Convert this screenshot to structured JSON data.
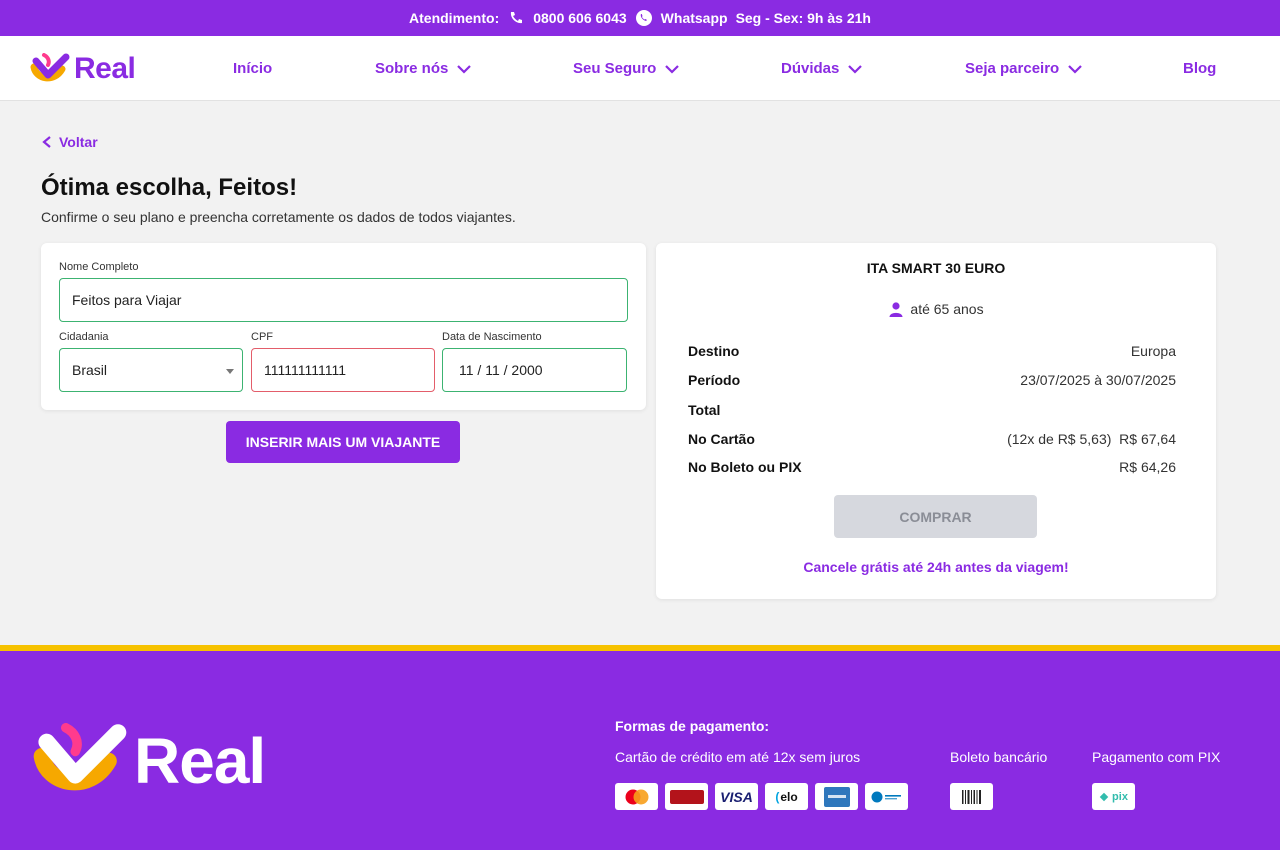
{
  "topbar": {
    "label": "Atendimento:",
    "phone": "0800 606 6043",
    "whatsapp": "Whatsapp",
    "hours": "Seg - Sex: 9h às 21h"
  },
  "nav": {
    "logo": "Real",
    "items": [
      {
        "label": "Início"
      },
      {
        "label": "Sobre nós"
      },
      {
        "label": "Seu Seguro"
      },
      {
        "label": "Dúvidas"
      },
      {
        "label": "Seja parceiro"
      },
      {
        "label": "Blog"
      }
    ]
  },
  "page": {
    "back": "Voltar",
    "title": "Ótima escolha, Feitos!",
    "subtitle": "Confirme o seu plano e preencha corretamente os dados de todos viajantes."
  },
  "form": {
    "name_label": "Nome Completo",
    "name_value": "Feitos para Viajar",
    "citizenship_label": "Cidadania",
    "citizenship_value": "Brasil",
    "cpf_label": "CPF",
    "cpf_value": "111111111111",
    "birth_label": "Data de Nascimento",
    "birth_value": "11 / 11 / 2000",
    "add_button": "INSERIR MAIS UM VIAJANTE"
  },
  "summary": {
    "plan": "ITA SMART 30 EURO",
    "age": "até 65 anos",
    "rows": [
      {
        "k": "Destino",
        "v": "Europa"
      },
      {
        "k": "Período",
        "v": "23/07/2025 à 30/07/2025"
      },
      {
        "k": "Total",
        "v": ""
      },
      {
        "k": "No Cartão",
        "v": "(12x de R$ 5,63)  R$ 67,64"
      },
      {
        "k": "No Boleto ou PIX",
        "v": "R$ 64,26"
      }
    ],
    "buy": "COMPRAR",
    "cancel": "Cancele grátis até 24h antes da viagem!"
  },
  "footer": {
    "logo": "Real",
    "pay_title": "Formas de pagamento:",
    "card_label": "Cartão de crédito em até 12x sem juros",
    "boleto_label": "Boleto bancário",
    "pix_label": "Pagamento com PIX",
    "cards": [
      "mastercard-icon",
      "hipercard-icon",
      "visa-icon",
      "elo-icon",
      "amex-icon",
      "diners-icon"
    ],
    "visa_text": "VISA",
    "elo_text": "elo",
    "pix_text": "pix"
  },
  "colors": {
    "brand": "#8a2be2",
    "accent": "#f6c200",
    "success": "#3cb371",
    "error": "#e35d6a"
  }
}
